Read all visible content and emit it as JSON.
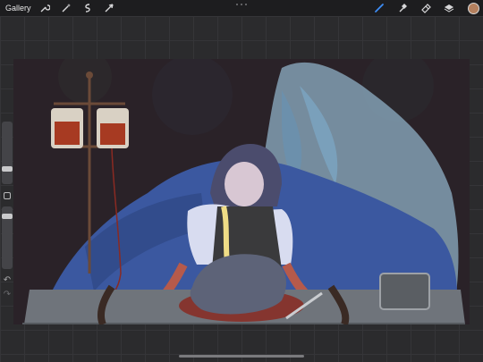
{
  "topbar": {
    "gallery_label": "Gallery",
    "left_tools": [
      {
        "icon": "wrench-icon"
      },
      {
        "icon": "magic-wand-icon"
      },
      {
        "icon": "selection-icon"
      },
      {
        "icon": "transform-arrow-icon"
      }
    ],
    "right_tools": [
      {
        "icon": "brush-icon",
        "color": "#3d8df5"
      },
      {
        "icon": "smudge-icon"
      },
      {
        "icon": "eraser-icon"
      },
      {
        "icon": "layers-icon"
      }
    ],
    "current_color": "#b4805e"
  },
  "sidebar": {
    "brush_size_level": 0.54,
    "opacity_level": 0.52,
    "modify_button_icon": "square-icon",
    "undo_icon": "undo-arrow-icon",
    "redo_icon": "redo-arrow-icon"
  },
  "canvas": {
    "background_color": "#2a2228",
    "ghost_color": "#8fb0c6",
    "drape_color": "#3b58a0",
    "table_color": "#6f747b",
    "blood_color": "#8a2a22"
  }
}
